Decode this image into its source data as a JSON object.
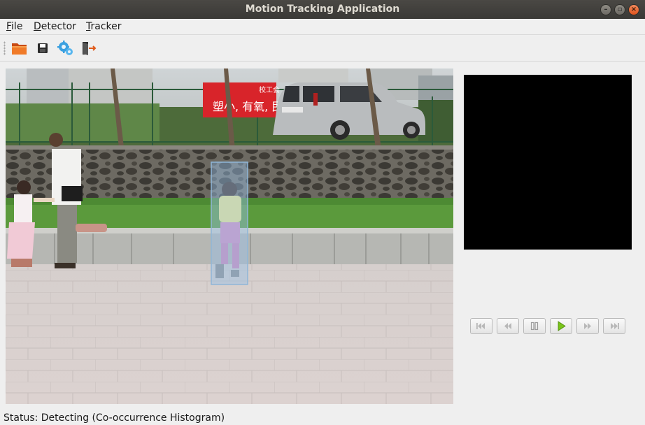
{
  "window": {
    "title": "Motion Tracking Application"
  },
  "menubar": {
    "items": [
      {
        "mnemonic": "F",
        "rest": "ile"
      },
      {
        "mnemonic": "D",
        "rest": "etector"
      },
      {
        "mnemonic": "T",
        "rest": "racker"
      }
    ]
  },
  "toolbar": {
    "buttons": [
      {
        "icon": "folder-open-icon"
      },
      {
        "icon": "save-icon"
      },
      {
        "icon": "settings-gears-icon"
      },
      {
        "icon": "exit-door-icon"
      }
    ]
  },
  "scene": {
    "banner_text": "塑小, 有氧, 民",
    "banner_top_text": "校工会",
    "tracked_object": "child (detection box)"
  },
  "playback": {
    "buttons": [
      {
        "icon": "skip-to-start-icon"
      },
      {
        "icon": "rewind-icon"
      },
      {
        "icon": "pause-icon"
      },
      {
        "icon": "play-icon"
      },
      {
        "icon": "fast-forward-icon"
      },
      {
        "icon": "skip-to-end-icon"
      }
    ],
    "accent_color": "#7ac41a"
  },
  "status": {
    "text": "Status: Detecting (Co-occurrence Histogram)"
  }
}
